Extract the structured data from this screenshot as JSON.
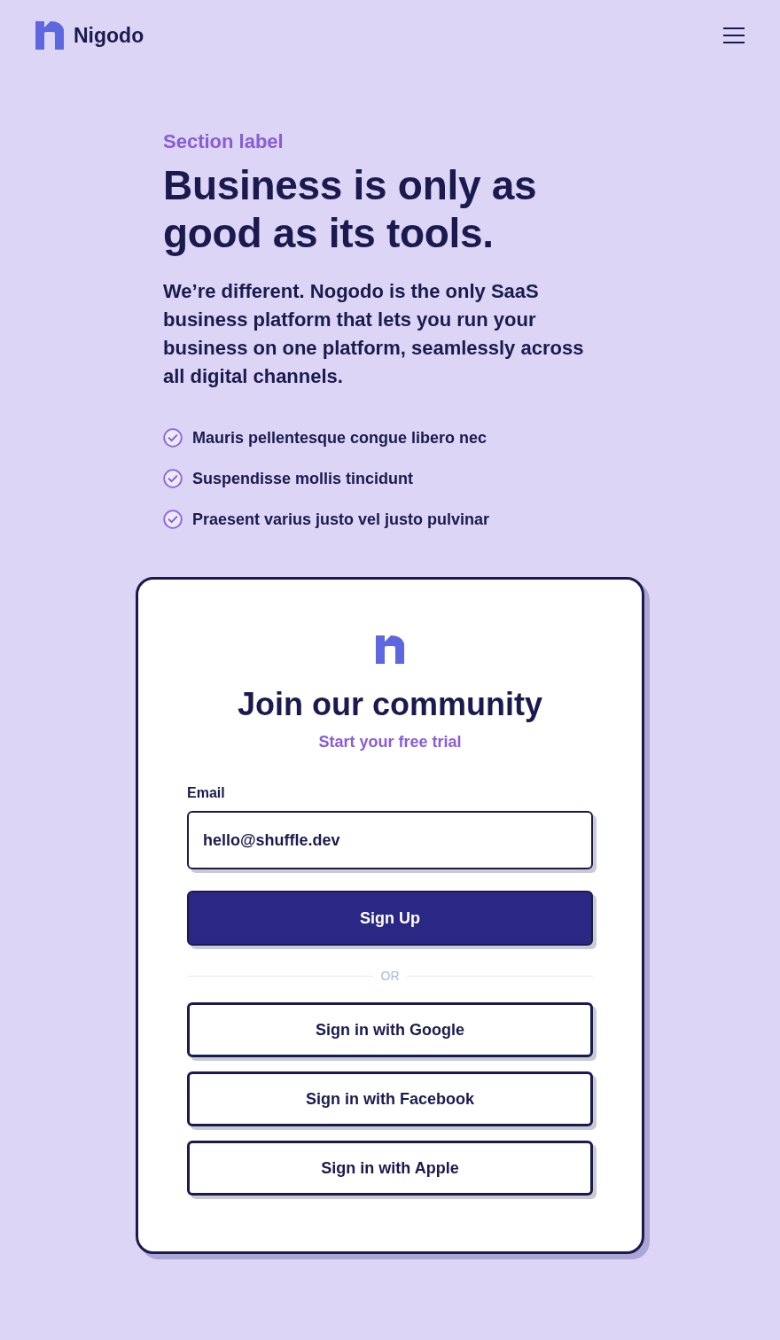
{
  "header": {
    "brand": "Nigodo"
  },
  "hero": {
    "section_label": "Section label",
    "title": "Business is only as good as its tools.",
    "description": "We’re different. Nogodo is the only SaaS business platform that lets you run your business on one platform, seamlessly across all digital channels.",
    "features": [
      "Mauris pellentesque congue libero nec",
      "Suspendisse mollis tincidunt",
      "Praesent varius justo vel justo pulvinar"
    ]
  },
  "signup_card": {
    "title": "Join our community",
    "subtitle": "Start your free trial",
    "email": {
      "label": "Email",
      "value": "hello@shuffle.dev"
    },
    "submit_button": "Sign Up",
    "divider": "OR",
    "social_buttons": [
      "Sign in with Google",
      "Sign in with Facebook",
      "Sign in with Apple"
    ]
  }
}
